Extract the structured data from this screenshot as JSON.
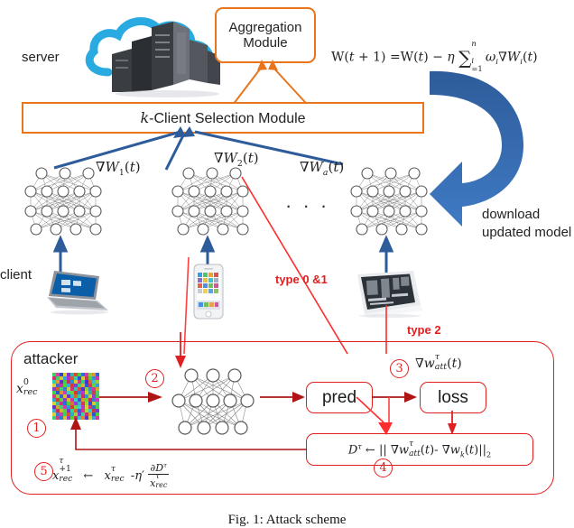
{
  "figure": {
    "caption": "Fig. 1: Attack scheme"
  },
  "server_section": {
    "server_label": "server",
    "aggregation_module": {
      "line1": "Aggregation",
      "line2": "Module"
    },
    "update_formula": "W(t + 1) =W(t) − η ∑ᵢ₌₁ⁿ ωᵢ∇Wᵢ(t)",
    "selection_module_label": "k-Client Selection Module",
    "selection_module_prefix": "k",
    "selection_module_rest": "-Client Selection Module"
  },
  "download": {
    "line1": "download",
    "line2": "updated model"
  },
  "clients": {
    "client_label": "client",
    "gradients": [
      {
        "label": "∇W₁(t)"
      },
      {
        "label": "∇W₂(t)"
      },
      {
        "label": "∇Wₐ(t)"
      }
    ],
    "ellipsis": "· · ·",
    "attack_types": [
      {
        "label": "type 0 &1"
      },
      {
        "label": "type 2"
      }
    ]
  },
  "attacker": {
    "title": "attacker",
    "input_label": "x⁰rec",
    "grad_att_label": "∇wᵗatt(t)",
    "pred_box": "pred",
    "loss_box": "loss",
    "distance_formula": "Dᵗ ← || ∇wᵗatt(t)- ∇wₖ(t)||₂",
    "update_formula": "x^{τ+1}rec ← x^τrec -η′ ∂Dᵗ / xᵗrec",
    "steps": [
      {
        "number": "1"
      },
      {
        "number": "2"
      },
      {
        "number": "3"
      },
      {
        "number": "4"
      },
      {
        "number": "5"
      }
    ]
  },
  "colors": {
    "orange": "#E8741C",
    "red": "#E02020",
    "blue": "#2E5C9A",
    "cloud_cyan": "#29ABE2"
  }
}
